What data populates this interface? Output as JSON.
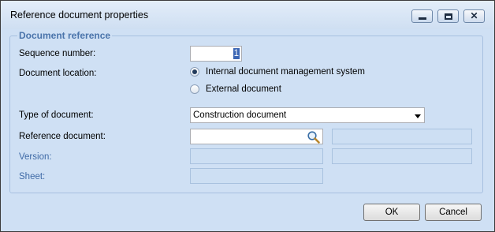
{
  "window": {
    "title": "Reference document properties",
    "close_glyph": "✕"
  },
  "group": {
    "title": "Document reference"
  },
  "fields": {
    "sequence_number": {
      "label": "Sequence number:",
      "value": "1"
    },
    "document_location": {
      "label": "Document location:",
      "options": [
        {
          "label": "Internal document management system",
          "selected": true
        },
        {
          "label": "External document",
          "selected": false
        }
      ]
    },
    "type_of_document": {
      "label": "Type of document:",
      "value": "Construction document"
    },
    "reference_document": {
      "label": "Reference document:",
      "value": ""
    },
    "version": {
      "label": "Version:",
      "value": ""
    },
    "sheet": {
      "label": "Sheet:",
      "value": ""
    }
  },
  "buttons": {
    "ok": "OK",
    "cancel": "Cancel"
  },
  "colors": {
    "background": "#cfe0f4",
    "accent_label": "#3f6aa6",
    "group_title": "#4a74ab"
  }
}
